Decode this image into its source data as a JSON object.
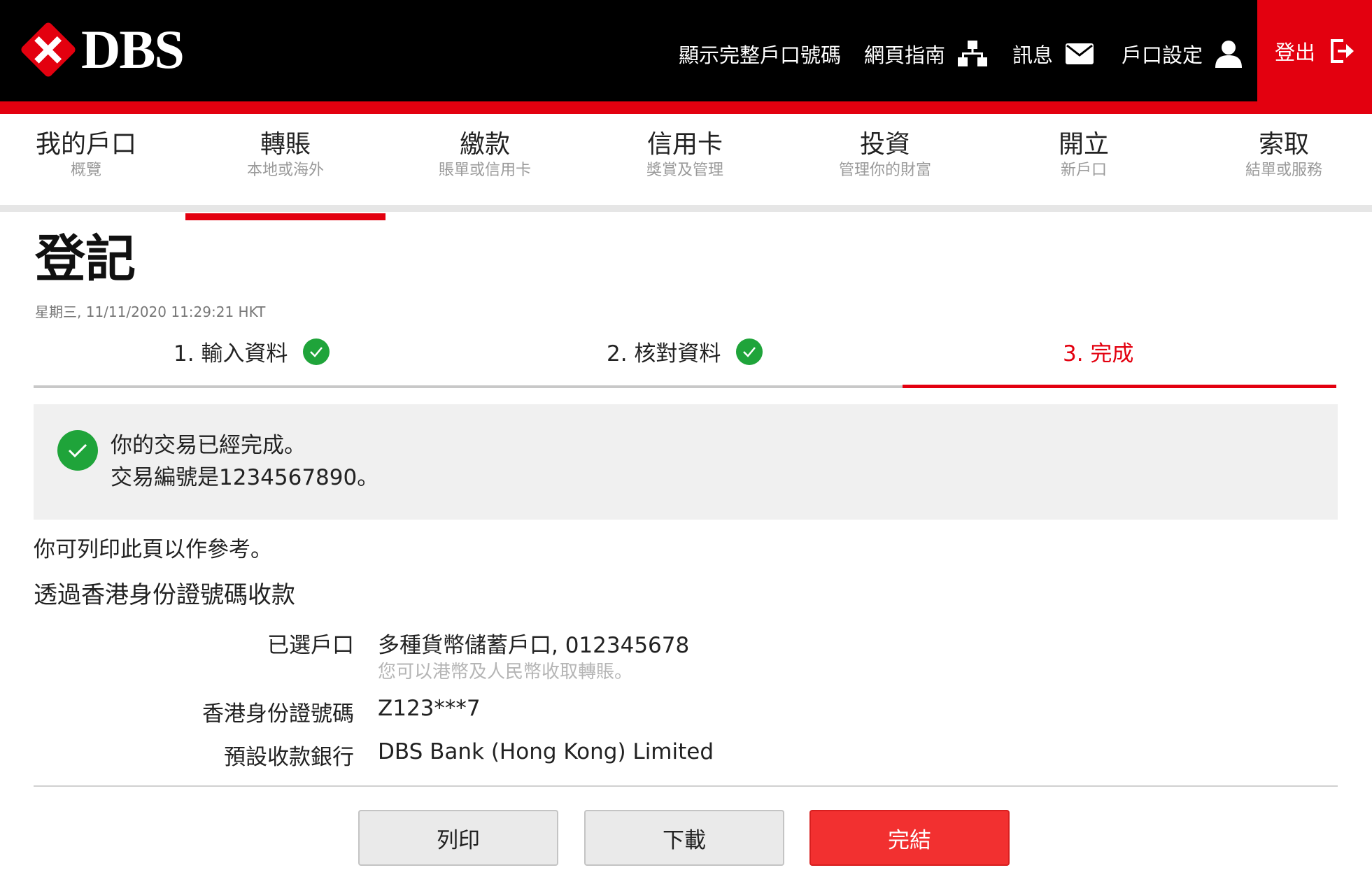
{
  "header": {
    "logo_text": "DBS",
    "links": [
      {
        "label": "顯示完整戶口號碼"
      },
      {
        "label": "網頁指南",
        "icon": "sitemap-icon"
      },
      {
        "label": "訊息",
        "icon": "envelope-icon"
      },
      {
        "label": "戶口設定",
        "icon": "user-icon"
      }
    ],
    "logout": {
      "label": "登出",
      "icon": "logout-icon"
    }
  },
  "main_nav": [
    {
      "title": "我的戶口",
      "subtitle": "概覽"
    },
    {
      "title": "轉賬",
      "subtitle": "本地或海外",
      "active": true
    },
    {
      "title": "繳款",
      "subtitle": "賬單或信用卡"
    },
    {
      "title": "信用卡",
      "subtitle": "獎賞及管理"
    },
    {
      "title": "投資",
      "subtitle": "管理你的財富"
    },
    {
      "title": "開立",
      "subtitle": "新戶口"
    },
    {
      "title": "索取",
      "subtitle": "結單或服務"
    }
  ],
  "page": {
    "title": "登記",
    "timestamp": "星期三, 11/11/2020 11:29:21 HKT"
  },
  "steps": [
    {
      "label": "1. 輸入資料",
      "status": "done"
    },
    {
      "label": "2. 核對資料",
      "status": "done"
    },
    {
      "label": "3. 完成",
      "status": "current"
    }
  ],
  "success": {
    "line1": "你的交易已經完成。",
    "line2": "交易編號是1234567890。"
  },
  "print_note": "你可列印此頁以作參考。",
  "section_title": "透過香港身份證號碼收款",
  "details": {
    "account_label": "已選戶口",
    "account_value": "多種貨幣儲蓄戶口, 012345678",
    "account_note": "您可以港幣及人民幣收取轉賬。",
    "hkid_label": "香港身份證號碼",
    "hkid_value": "Z123***7",
    "bank_label": "預設收款銀行",
    "bank_value": "DBS Bank (Hong Kong) Limited"
  },
  "buttons": {
    "print": "列印",
    "download": "下載",
    "finish": "完結"
  },
  "colors": {
    "brand_red": "#e3000f",
    "button_red": "#f23030",
    "success_green": "#1fa43a"
  }
}
